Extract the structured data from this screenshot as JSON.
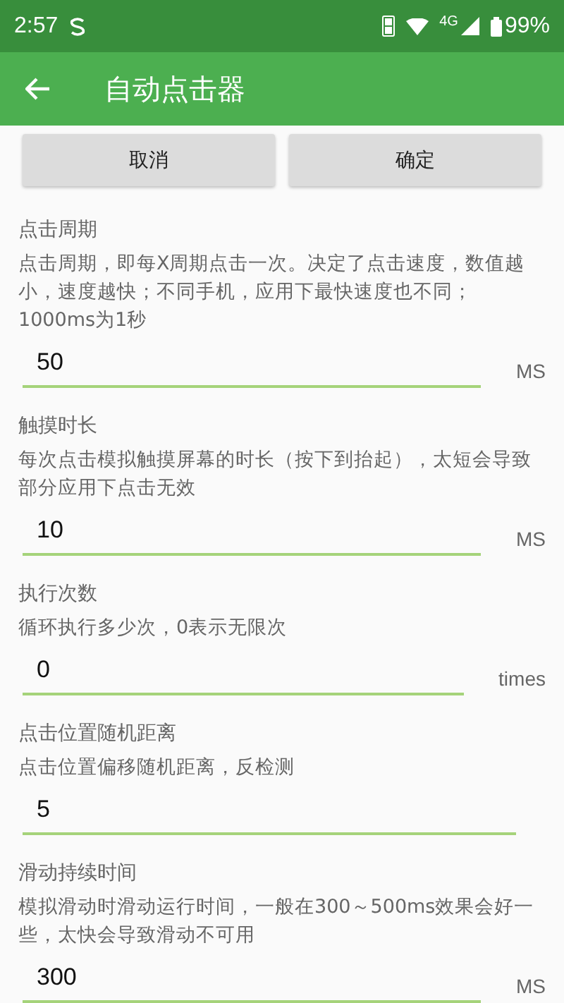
{
  "status_bar": {
    "time": "2:57",
    "network": "4G",
    "battery": "99%"
  },
  "toolbar": {
    "title": "自动点击器"
  },
  "buttons": [
    "取消",
    "确定"
  ],
  "settings": [
    {
      "title": "点击周期",
      "description": "点击周期，即每X周期点击一次。决定了点击速度，数值越小，速度越快；不同手机，应用下最快速度也不同；1000ms为1秒",
      "value": "50",
      "unit": "MS"
    },
    {
      "title": "触摸时长",
      "description": "每次点击模拟触摸屏幕的时长（按下到抬起），太短会导致部分应用下点击无效",
      "value": "10",
      "unit": "MS"
    },
    {
      "title": "执行次数",
      "description": "循环执行多少次，0表示无限次",
      "value": "0",
      "unit": "times"
    },
    {
      "title": "点击位置随机距离",
      "description": "点击位置偏移随机距离，反检测",
      "value": "5"
    },
    {
      "title": "滑动持续时间",
      "description": "模拟滑动时滑动运行时间，一般在300～500ms效果会好一些，太快会导致滑动不可用",
      "value": "300",
      "unit": "MS"
    }
  ]
}
